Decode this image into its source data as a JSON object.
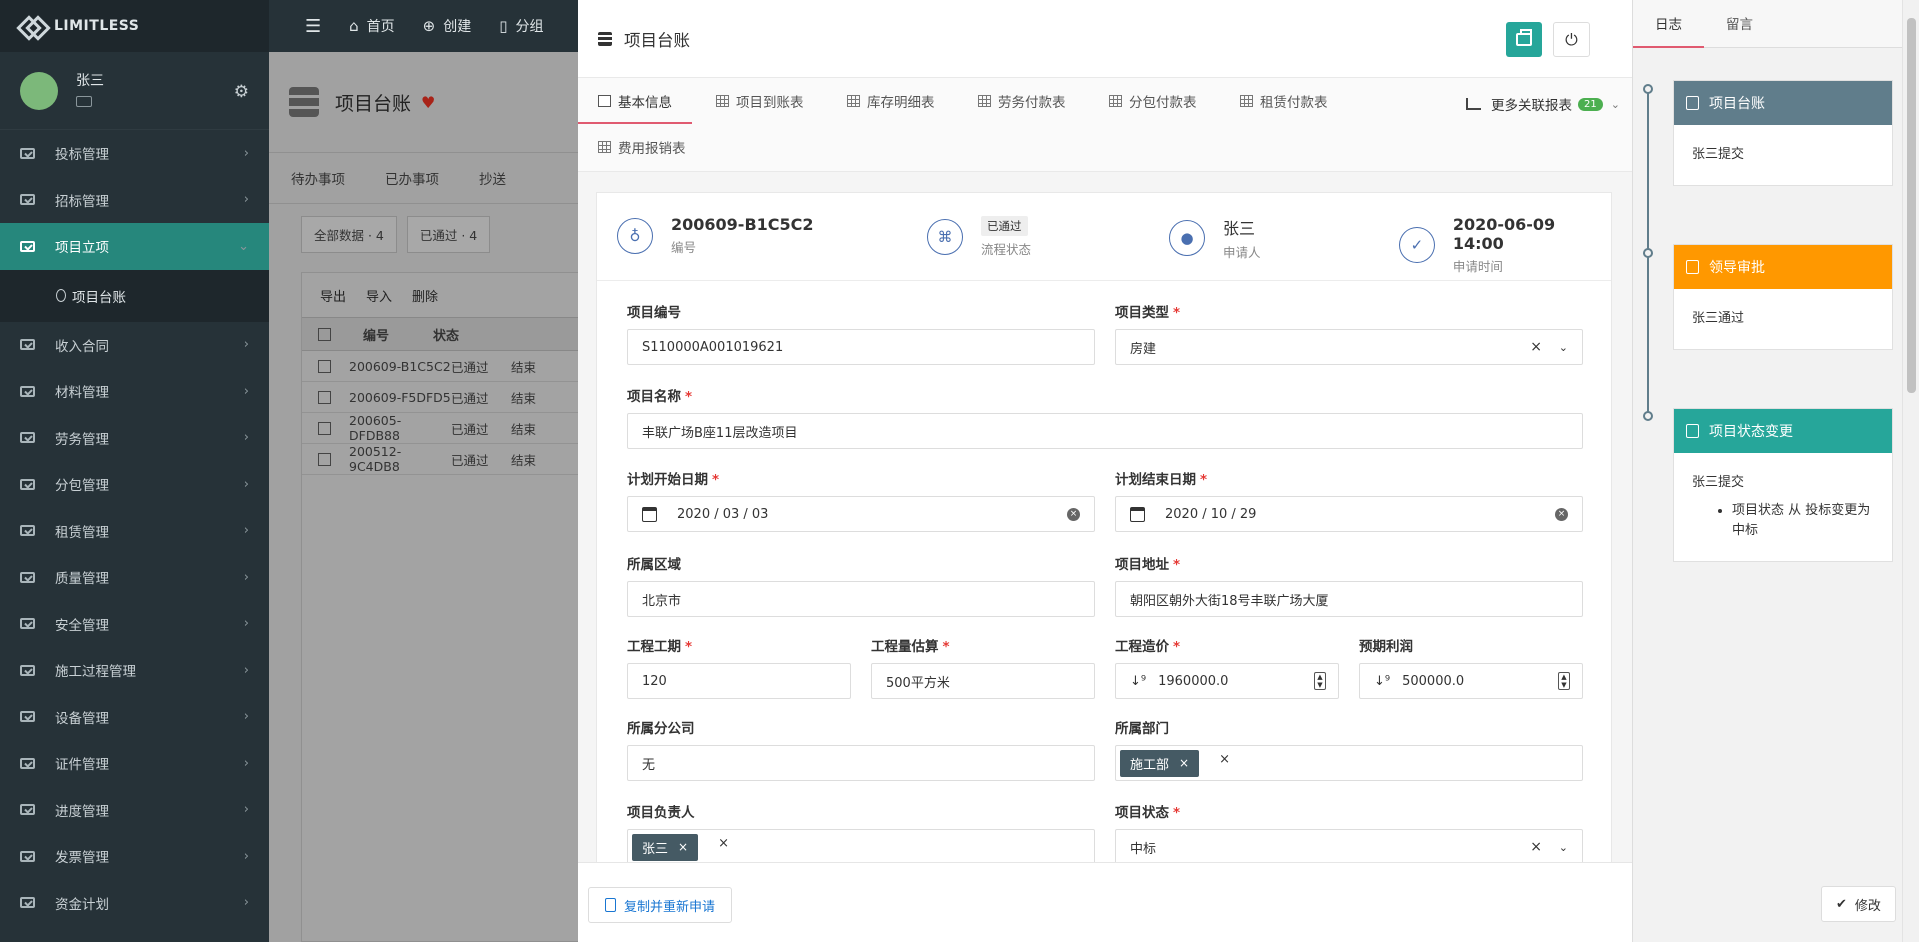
{
  "brand": {
    "name": "LIMITLESS"
  },
  "user": {
    "name": "张三"
  },
  "sidebar": {
    "items": [
      {
        "label": "投标管理"
      },
      {
        "label": "招标管理"
      },
      {
        "label": "项目立项"
      },
      {
        "label": "收入合同"
      },
      {
        "label": "材料管理"
      },
      {
        "label": "劳务管理"
      },
      {
        "label": "分包管理"
      },
      {
        "label": "租赁管理"
      },
      {
        "label": "质量管理"
      },
      {
        "label": "安全管理"
      },
      {
        "label": "施工过程管理"
      },
      {
        "label": "设备管理"
      },
      {
        "label": "证件管理"
      },
      {
        "label": "进度管理"
      },
      {
        "label": "发票管理"
      },
      {
        "label": "资金计划"
      }
    ],
    "active_index": 2,
    "submenu": {
      "label": "项目台账"
    }
  },
  "topbar": {
    "home": "首页",
    "create": "创建",
    "share": "分组"
  },
  "background_page": {
    "title": "项目台账",
    "tabs": [
      "待办事项",
      "已办事项",
      "抄送"
    ],
    "filters": [
      "全部数据 · 4",
      "已通过 · 4"
    ],
    "toolbar": [
      "导出",
      "导入",
      "删除"
    ],
    "columns": [
      "编号",
      "状态"
    ],
    "rows": [
      [
        "200609-B1C5C2",
        "已通过",
        "结束"
      ],
      [
        "200609-F5DFD5",
        "已通过",
        "结束"
      ],
      [
        "200605-DFDB88",
        "已通过",
        "结束"
      ],
      [
        "200512-9C4DB8",
        "已通过",
        "结束"
      ]
    ]
  },
  "dialog": {
    "title": "项目台账",
    "tabs": [
      "基本信息",
      "项目到账表",
      "库存明细表",
      "劳务付款表",
      "分包付款表",
      "租赁付款表",
      "费用报销表"
    ],
    "more_reports": {
      "label": "更多关联报表",
      "count": "21"
    },
    "summary": {
      "id": {
        "value": "200609-B1C5C2",
        "label": "编号"
      },
      "status": {
        "value": "已通过",
        "label": "流程状态"
      },
      "applicant": {
        "value": "张三",
        "label": "申请人"
      },
      "time": {
        "value": "2020-06-09 14:00",
        "label": "申请时间"
      }
    },
    "form": {
      "project_no": {
        "label": "项目编号",
        "value": "S110000A001019621"
      },
      "project_type": {
        "label": "项目类型",
        "value": "房建"
      },
      "project_name": {
        "label": "项目名称",
        "value": "丰联广场B座11层改造项目"
      },
      "plan_start": {
        "label": "计划开始日期",
        "value": "2020 / 03 / 03"
      },
      "plan_end": {
        "label": "计划结束日期",
        "value": "2020 / 10 / 29"
      },
      "region": {
        "label": "所属区域",
        "value": "北京市"
      },
      "address": {
        "label": "项目地址",
        "value": "朝阳区朝外大街18号丰联广场大厦"
      },
      "duration": {
        "label": "工程工期",
        "value": "120"
      },
      "quantity": {
        "label": "工程量估算",
        "value": "500平方米"
      },
      "cost": {
        "label": "工程造价",
        "value": "1960000.0"
      },
      "profit": {
        "label": "预期利润",
        "value": "500000.0"
      },
      "branch": {
        "label": "所属分公司",
        "value": "无"
      },
      "department": {
        "label": "所属部门",
        "value": "施工部"
      },
      "manager": {
        "label": "项目负责人",
        "value": "张三"
      },
      "state": {
        "label": "项目状态",
        "value": "中标"
      }
    },
    "copy_button": "复制并重新申请"
  },
  "log_panel": {
    "tabs": [
      "日志",
      "留言"
    ],
    "entries": [
      {
        "title": "项目台账",
        "body": "张三提交",
        "color": "#607d8b"
      },
      {
        "title": "领导审批",
        "body": "张三通过",
        "color": "#ff9800"
      },
      {
        "title": "项目状态变更",
        "body": "张三提交",
        "detail": "项目状态 从 投标变更为 中标",
        "color": "#26a69a"
      }
    ],
    "edit_button": "修改"
  }
}
